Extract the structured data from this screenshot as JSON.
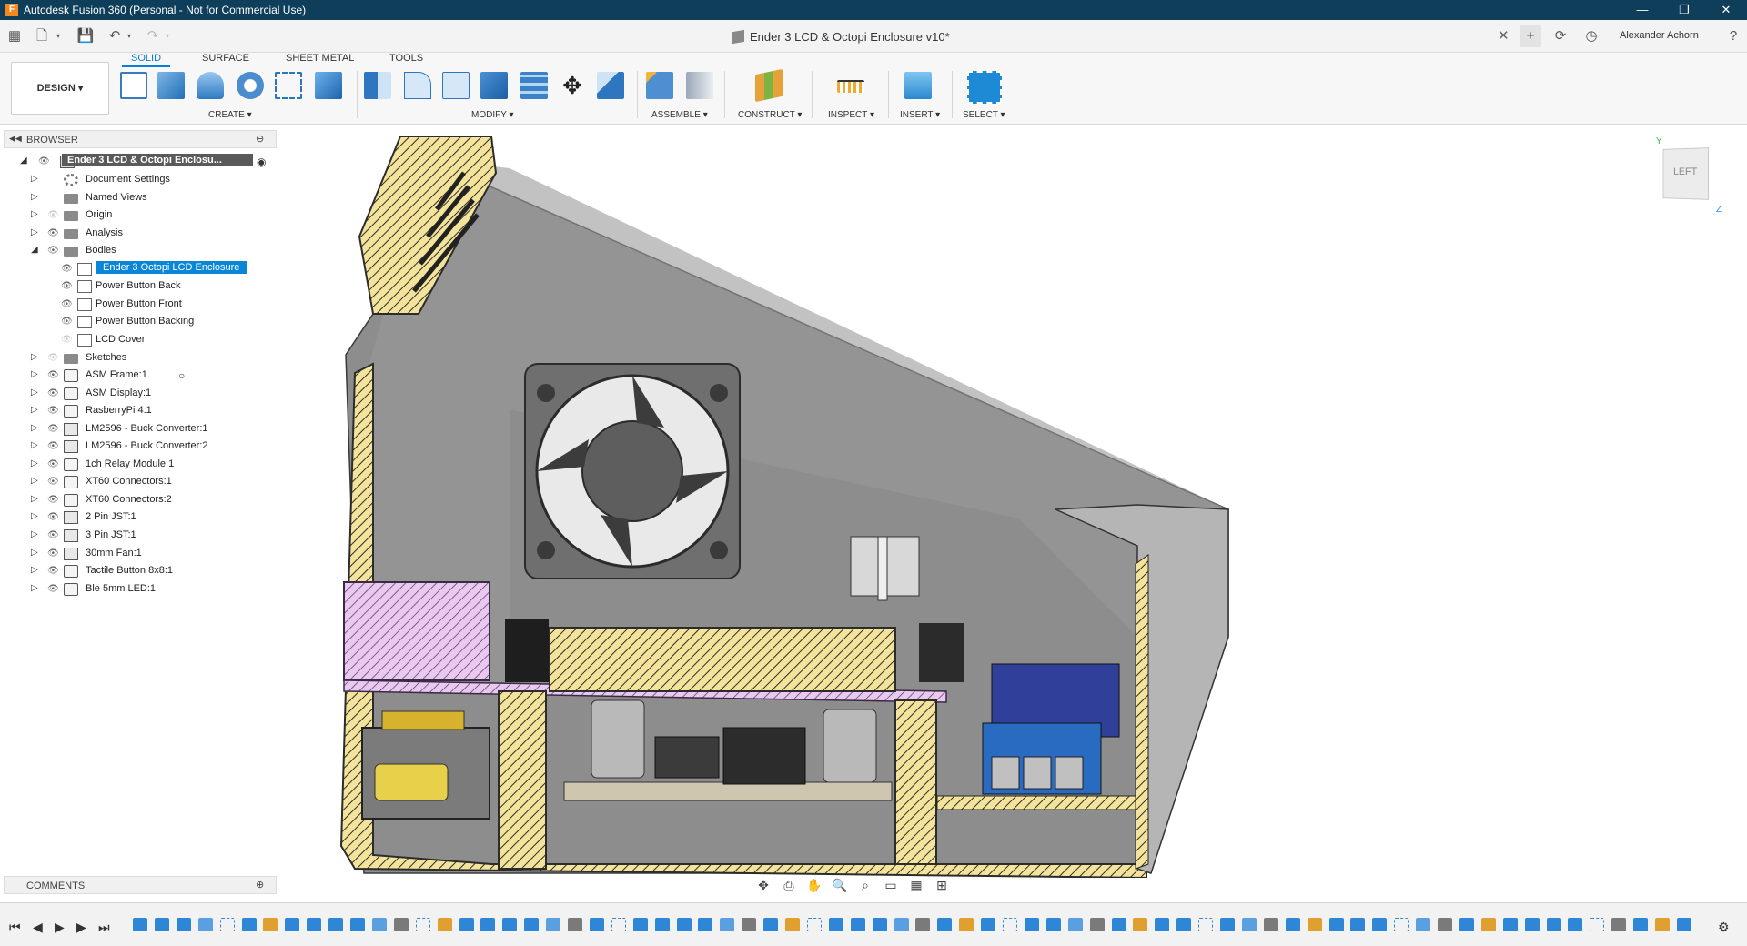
{
  "window": {
    "title": "Autodesk Fusion 360 (Personal - Not for Commercial Use)",
    "app_icon": "fusion-icon",
    "controls": [
      "minimize-icon",
      "restore-icon",
      "close-icon"
    ]
  },
  "document": {
    "tab_title": "Ender 3 LCD & Octopi Enclosure v10*",
    "user": "Alexander Achorn"
  },
  "workspace": {
    "label": "DESIGN ▾"
  },
  "toolbar": {
    "tabs": [
      "SOLID",
      "SURFACE",
      "SHEET METAL",
      "TOOLS"
    ],
    "active_tab": "SOLID",
    "groups": {
      "create": "CREATE ▾",
      "modify": "MODIFY ▾",
      "assemble": "ASSEMBLE ▾",
      "construct": "CONSTRUCT ▾",
      "inspect": "INSPECT ▾",
      "insert": "INSERT ▾",
      "select": "SELECT ▾"
    },
    "accent": "#0a7ed3"
  },
  "browser": {
    "title": "BROWSER",
    "root": "Ender 3 LCD & Octopi Enclosu...",
    "items": [
      {
        "label": "Document Settings"
      },
      {
        "label": "Named Views"
      },
      {
        "label": "Origin"
      },
      {
        "label": "Analysis"
      },
      {
        "label": "Bodies"
      },
      {
        "label": "Ender 3 Octopi LCD Enclosure"
      },
      {
        "label": "Power Button Back"
      },
      {
        "label": "Power Button Front"
      },
      {
        "label": "Power Button Backing"
      },
      {
        "label": "LCD Cover"
      },
      {
        "label": "Sketches"
      },
      {
        "label": "ASM Frame:1"
      },
      {
        "label": "ASM Display:1"
      },
      {
        "label": "RasberryPi 4:1"
      },
      {
        "label": "LM2596 - Buck Converter:1"
      },
      {
        "label": "LM2596 - Buck Converter:2"
      },
      {
        "label": "1ch Relay Module:1"
      },
      {
        "label": "XT60 Connectors:1"
      },
      {
        "label": "XT60 Connectors:2"
      },
      {
        "label": "2 Pin JST:1"
      },
      {
        "label": "3 Pin JST:1"
      },
      {
        "label": "30mm Fan:1"
      },
      {
        "label": "Tactile Button 8x8:1"
      },
      {
        "label": "Ble 5mm LED:1"
      }
    ]
  },
  "comments": {
    "title": "COMMENTS"
  },
  "viewcube": {
    "face": "LEFT",
    "axis_y": "Y",
    "axis_z": "Z"
  }
}
